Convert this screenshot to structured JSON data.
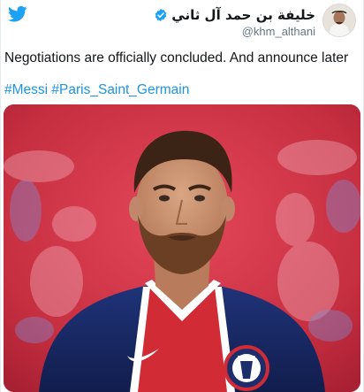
{
  "tweet": {
    "author": {
      "display_name": "خليفة بن حمد آل ثاني",
      "handle": "@khm_althani",
      "verified_icon": "verified-badge-icon",
      "avatar_icon": "avatar"
    },
    "text": "Negotiations are officially concluded. And announce later",
    "hashtags": [
      "#Messi",
      "#Paris_Saint_Germain"
    ],
    "media": {
      "kind": "photo",
      "crest_text": "PARIS"
    }
  },
  "colors": {
    "twitter_blue": "#1da1f2",
    "hashtag_blue": "#1b95e0",
    "text": "#14171a",
    "handle_gray": "#657786",
    "photo_red": "#c52a3a",
    "jersey_navy": "#16265f"
  },
  "icons": {
    "brand": "twitter-bird-icon"
  }
}
